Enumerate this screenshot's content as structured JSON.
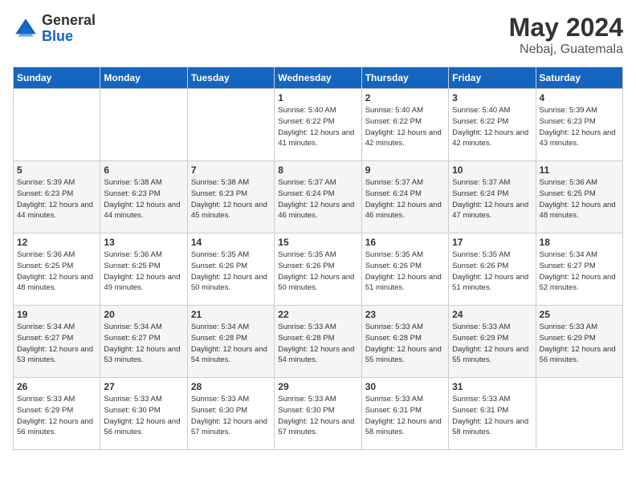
{
  "logo": {
    "general": "General",
    "blue": "Blue"
  },
  "title": {
    "month_year": "May 2024",
    "location": "Nebaj, Guatemala"
  },
  "days_of_week": [
    "Sunday",
    "Monday",
    "Tuesday",
    "Wednesday",
    "Thursday",
    "Friday",
    "Saturday"
  ],
  "weeks": [
    [
      {
        "day": "",
        "sunrise": "",
        "sunset": "",
        "daylight": ""
      },
      {
        "day": "",
        "sunrise": "",
        "sunset": "",
        "daylight": ""
      },
      {
        "day": "",
        "sunrise": "",
        "sunset": "",
        "daylight": ""
      },
      {
        "day": "1",
        "sunrise": "5:40 AM",
        "sunset": "6:22 PM",
        "daylight": "12 hours and 41 minutes."
      },
      {
        "day": "2",
        "sunrise": "5:40 AM",
        "sunset": "6:22 PM",
        "daylight": "12 hours and 42 minutes."
      },
      {
        "day": "3",
        "sunrise": "5:40 AM",
        "sunset": "6:22 PM",
        "daylight": "12 hours and 42 minutes."
      },
      {
        "day": "4",
        "sunrise": "5:39 AM",
        "sunset": "6:23 PM",
        "daylight": "12 hours and 43 minutes."
      }
    ],
    [
      {
        "day": "5",
        "sunrise": "5:39 AM",
        "sunset": "6:23 PM",
        "daylight": "12 hours and 44 minutes."
      },
      {
        "day": "6",
        "sunrise": "5:38 AM",
        "sunset": "6:23 PM",
        "daylight": "12 hours and 44 minutes."
      },
      {
        "day": "7",
        "sunrise": "5:38 AM",
        "sunset": "6:23 PM",
        "daylight": "12 hours and 45 minutes."
      },
      {
        "day": "8",
        "sunrise": "5:37 AM",
        "sunset": "6:24 PM",
        "daylight": "12 hours and 46 minutes."
      },
      {
        "day": "9",
        "sunrise": "5:37 AM",
        "sunset": "6:24 PM",
        "daylight": "12 hours and 46 minutes."
      },
      {
        "day": "10",
        "sunrise": "5:37 AM",
        "sunset": "6:24 PM",
        "daylight": "12 hours and 47 minutes."
      },
      {
        "day": "11",
        "sunrise": "5:36 AM",
        "sunset": "6:25 PM",
        "daylight": "12 hours and 48 minutes."
      }
    ],
    [
      {
        "day": "12",
        "sunrise": "5:36 AM",
        "sunset": "6:25 PM",
        "daylight": "12 hours and 48 minutes."
      },
      {
        "day": "13",
        "sunrise": "5:36 AM",
        "sunset": "6:25 PM",
        "daylight": "12 hours and 49 minutes."
      },
      {
        "day": "14",
        "sunrise": "5:35 AM",
        "sunset": "6:26 PM",
        "daylight": "12 hours and 50 minutes."
      },
      {
        "day": "15",
        "sunrise": "5:35 AM",
        "sunset": "6:26 PM",
        "daylight": "12 hours and 50 minutes."
      },
      {
        "day": "16",
        "sunrise": "5:35 AM",
        "sunset": "6:26 PM",
        "daylight": "12 hours and 51 minutes."
      },
      {
        "day": "17",
        "sunrise": "5:35 AM",
        "sunset": "6:26 PM",
        "daylight": "12 hours and 51 minutes."
      },
      {
        "day": "18",
        "sunrise": "5:34 AM",
        "sunset": "6:27 PM",
        "daylight": "12 hours and 52 minutes."
      }
    ],
    [
      {
        "day": "19",
        "sunrise": "5:34 AM",
        "sunset": "6:27 PM",
        "daylight": "12 hours and 53 minutes."
      },
      {
        "day": "20",
        "sunrise": "5:34 AM",
        "sunset": "6:27 PM",
        "daylight": "12 hours and 53 minutes."
      },
      {
        "day": "21",
        "sunrise": "5:34 AM",
        "sunset": "6:28 PM",
        "daylight": "12 hours and 54 minutes."
      },
      {
        "day": "22",
        "sunrise": "5:33 AM",
        "sunset": "6:28 PM",
        "daylight": "12 hours and 54 minutes."
      },
      {
        "day": "23",
        "sunrise": "5:33 AM",
        "sunset": "6:28 PM",
        "daylight": "12 hours and 55 minutes."
      },
      {
        "day": "24",
        "sunrise": "5:33 AM",
        "sunset": "6:29 PM",
        "daylight": "12 hours and 55 minutes."
      },
      {
        "day": "25",
        "sunrise": "5:33 AM",
        "sunset": "6:29 PM",
        "daylight": "12 hours and 56 minutes."
      }
    ],
    [
      {
        "day": "26",
        "sunrise": "5:33 AM",
        "sunset": "6:29 PM",
        "daylight": "12 hours and 56 minutes."
      },
      {
        "day": "27",
        "sunrise": "5:33 AM",
        "sunset": "6:30 PM",
        "daylight": "12 hours and 56 minutes."
      },
      {
        "day": "28",
        "sunrise": "5:33 AM",
        "sunset": "6:30 PM",
        "daylight": "12 hours and 57 minutes."
      },
      {
        "day": "29",
        "sunrise": "5:33 AM",
        "sunset": "6:30 PM",
        "daylight": "12 hours and 57 minutes."
      },
      {
        "day": "30",
        "sunrise": "5:33 AM",
        "sunset": "6:31 PM",
        "daylight": "12 hours and 58 minutes."
      },
      {
        "day": "31",
        "sunrise": "5:33 AM",
        "sunset": "6:31 PM",
        "daylight": "12 hours and 58 minutes."
      },
      {
        "day": "",
        "sunrise": "",
        "sunset": "",
        "daylight": ""
      }
    ]
  ]
}
